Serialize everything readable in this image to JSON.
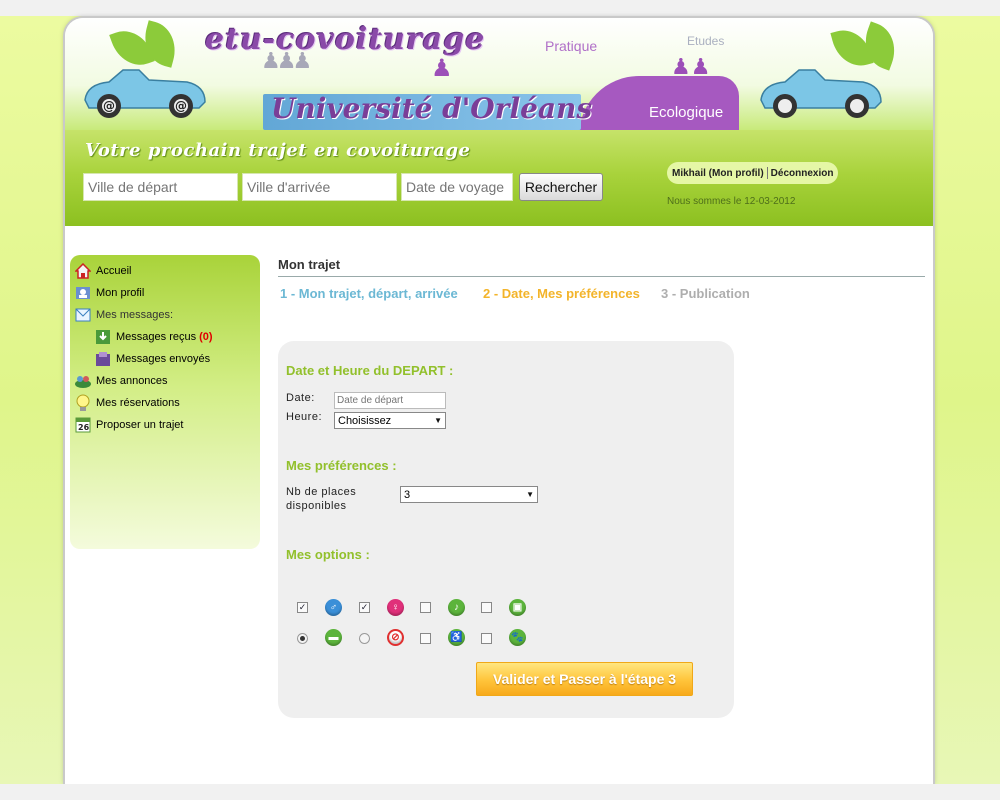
{
  "header": {
    "logo_text": "etu-covoiturage",
    "university": "Université d'Orléans",
    "word_pratique": "Pratique",
    "word_etudes": "Etudes",
    "word_ecologique": "Ecologique"
  },
  "search": {
    "title": "Votre prochain trajet en covoiturage",
    "departure_placeholder": "Ville de départ",
    "arrival_placeholder": "Ville d'arrivée",
    "date_placeholder": "Date de voyage",
    "button_label": "Rechercher"
  },
  "user": {
    "profile_label": "Mikhail (Mon profil)",
    "logout_label": "Déconnexion",
    "date_text": "Nous sommes le 12-03-2012"
  },
  "sidebar": {
    "home": "Accueil",
    "profile": "Mon profil",
    "messages": "Mes messages:",
    "received": "Messages reçus",
    "received_count": "(0)",
    "sent": "Messages envoyés",
    "ads": "Mes annonces",
    "reservations": "Mes réservations",
    "propose": "Proposer un trajet",
    "calendar_number": "26"
  },
  "main": {
    "title": "Mon trajet",
    "steps": [
      "1 - Mon trajet, départ, arrivée",
      "2 - Date, Mes préférences",
      "3 - Publication"
    ]
  },
  "form": {
    "departure_title": "Date et Heure du DEPART :",
    "date_label": "Date:",
    "date_placeholder": "Date de départ",
    "hour_label": "Heure:",
    "hour_value": "Choisissez",
    "prefs_title": "Mes préférences :",
    "seats_label_line1": "Nb de places",
    "seats_label_line2": "disponibles",
    "seats_value": "3",
    "options_title": "Mes options :",
    "submit_label": "Valider et Passer à l'étape 3"
  },
  "options": {
    "row1": [
      {
        "checked": true,
        "icon": "male-icon",
        "color": "#3a8fd8"
      },
      {
        "checked": true,
        "icon": "female-icon",
        "color": "#e0307a"
      },
      {
        "checked": false,
        "icon": "music-icon",
        "color": "#5cb43c"
      },
      {
        "checked": false,
        "icon": "luggage-icon",
        "color": "#5cb43c"
      }
    ],
    "row2": [
      {
        "type": "radio",
        "checked": true,
        "icon": "smoking-icon",
        "color": "#5cb43c"
      },
      {
        "type": "radio",
        "checked": false,
        "icon": "no-smoking-icon",
        "color": "#e03030"
      },
      {
        "type": "checkbox",
        "checked": false,
        "icon": "wheelchair-icon",
        "color": "#5cb43c"
      },
      {
        "type": "checkbox",
        "checked": false,
        "icon": "animal-icon",
        "color": "#5cb43c"
      }
    ]
  },
  "colors": {
    "accent_green": "#92c02c",
    "step_active": "#6cb8d4",
    "step_current": "#f3b42a",
    "step_inactive": "#aeaeae",
    "count_red": "#e00000"
  }
}
